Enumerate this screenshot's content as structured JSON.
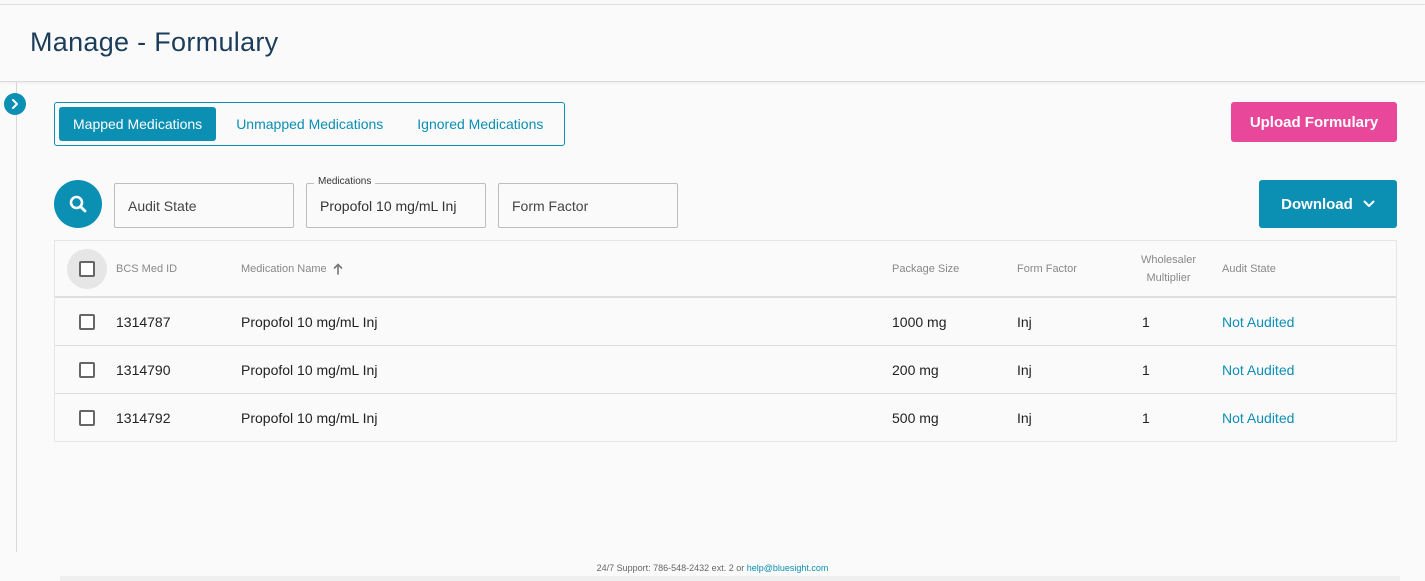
{
  "header": {
    "title": "Manage - Formulary"
  },
  "tabs": [
    {
      "label": "Mapped Medications",
      "active": true
    },
    {
      "label": "Unmapped Medications",
      "active": false
    },
    {
      "label": "Ignored Medications",
      "active": false
    }
  ],
  "actions": {
    "upload_label": "Upload Formulary",
    "download_label": "Download"
  },
  "filters": {
    "audit_state_placeholder": "Audit State",
    "medications_legend": "Medications",
    "medications_value": "Propofol 10 mg/mL Inj",
    "form_factor_placeholder": "Form Factor"
  },
  "table": {
    "columns": {
      "bcs_med_id": "BCS Med ID",
      "medication_name": "Medication Name",
      "package_size": "Package Size",
      "form_factor": "Form Factor",
      "wholesaler_multiplier_line1": "Wholesaler",
      "wholesaler_multiplier_line2": "Multiplier",
      "audit_state": "Audit State"
    },
    "sort": {
      "column": "medication_name",
      "direction": "ascending"
    },
    "rows": [
      {
        "id": "1314787",
        "name": "Propofol 10 mg/mL Inj",
        "package_size": "1000 mg",
        "form_factor": "Inj",
        "multiplier": "1",
        "audit_state": "Not Audited"
      },
      {
        "id": "1314790",
        "name": "Propofol 10 mg/mL Inj",
        "package_size": "200 mg",
        "form_factor": "Inj",
        "multiplier": "1",
        "audit_state": "Not Audited"
      },
      {
        "id": "1314792",
        "name": "Propofol 10 mg/mL Inj",
        "package_size": "500 mg",
        "form_factor": "Inj",
        "multiplier": "1",
        "audit_state": "Not Audited"
      }
    ]
  },
  "footer": {
    "support_text": "24/7 Support: 786-548-2432 ext. 2 or ",
    "email": "help@bluesight.com"
  },
  "colors": {
    "primary": "#0b8fb3",
    "upload_button": "#e8479a",
    "title": "#1c3d5a"
  }
}
